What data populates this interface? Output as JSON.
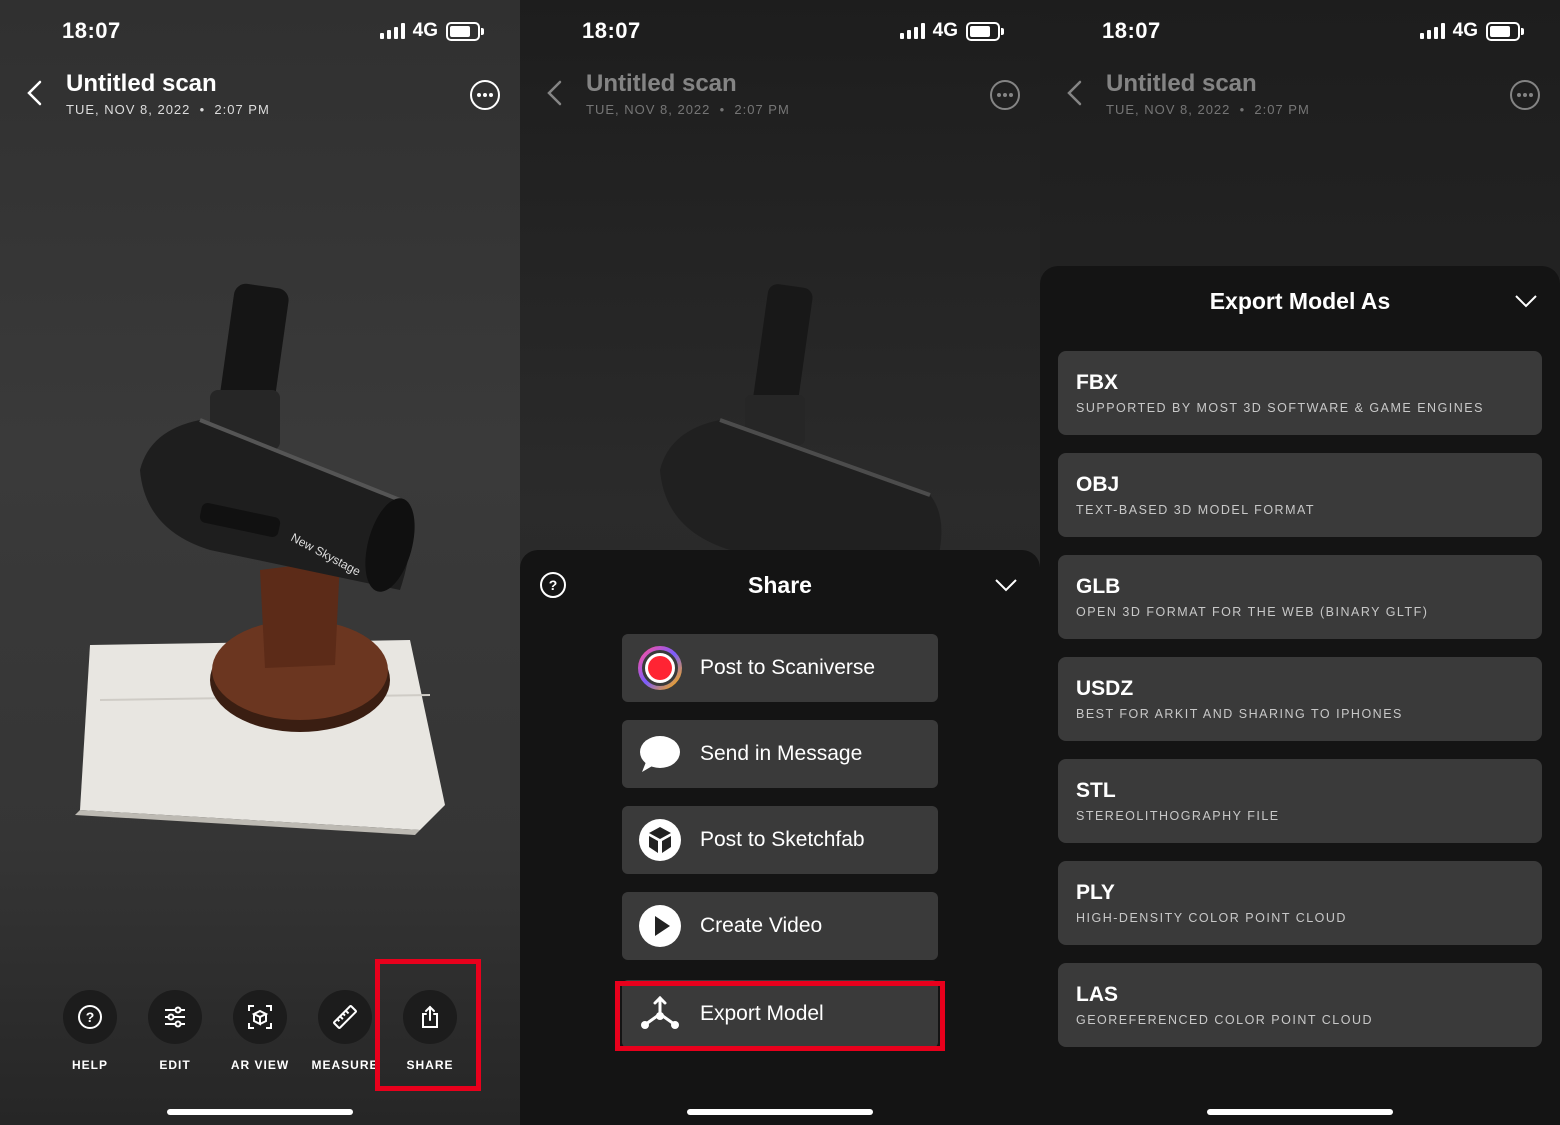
{
  "status": {
    "time": "18:07",
    "network": "4G"
  },
  "scan": {
    "title": "Untitled scan",
    "date": "TUE, NOV 8, 2022",
    "time": "2:07 PM"
  },
  "model": {
    "label": "New Skystage"
  },
  "toolbar": {
    "help": "HELP",
    "edit": "EDIT",
    "ar_view": "AR VIEW",
    "measure": "MEASURE",
    "share": "SHARE"
  },
  "share_sheet": {
    "title": "Share",
    "items": [
      {
        "label": "Post to Scaniverse",
        "icon": "scaniverse-logo-icon"
      },
      {
        "label": "Send in Message",
        "icon": "message-bubble-icon"
      },
      {
        "label": "Post to Sketchfab",
        "icon": "sketchfab-cube-icon"
      },
      {
        "label": "Create Video",
        "icon": "play-icon"
      },
      {
        "label": "Export Model",
        "icon": "export-nodes-icon"
      }
    ]
  },
  "export_sheet": {
    "title": "Export Model As",
    "formats": [
      {
        "name": "FBX",
        "desc": "SUPPORTED BY MOST 3D SOFTWARE & GAME ENGINES"
      },
      {
        "name": "OBJ",
        "desc": "TEXT-BASED 3D MODEL FORMAT"
      },
      {
        "name": "GLB",
        "desc": "OPEN 3D FORMAT FOR THE WEB (BINARY GLTF)"
      },
      {
        "name": "USDZ",
        "desc": "BEST FOR ARKIT AND SHARING TO IPHONES"
      },
      {
        "name": "STL",
        "desc": "STEREOLITHOGRAPHY FILE"
      },
      {
        "name": "PLY",
        "desc": "HIGH-DENSITY COLOR POINT CLOUD"
      },
      {
        "name": "LAS",
        "desc": "GEOREFERENCED COLOR POINT CLOUD"
      }
    ]
  },
  "colors": {
    "highlight": "#e8001c",
    "button_bg": "#3a3a3a",
    "sheet_bg": "#141414"
  }
}
